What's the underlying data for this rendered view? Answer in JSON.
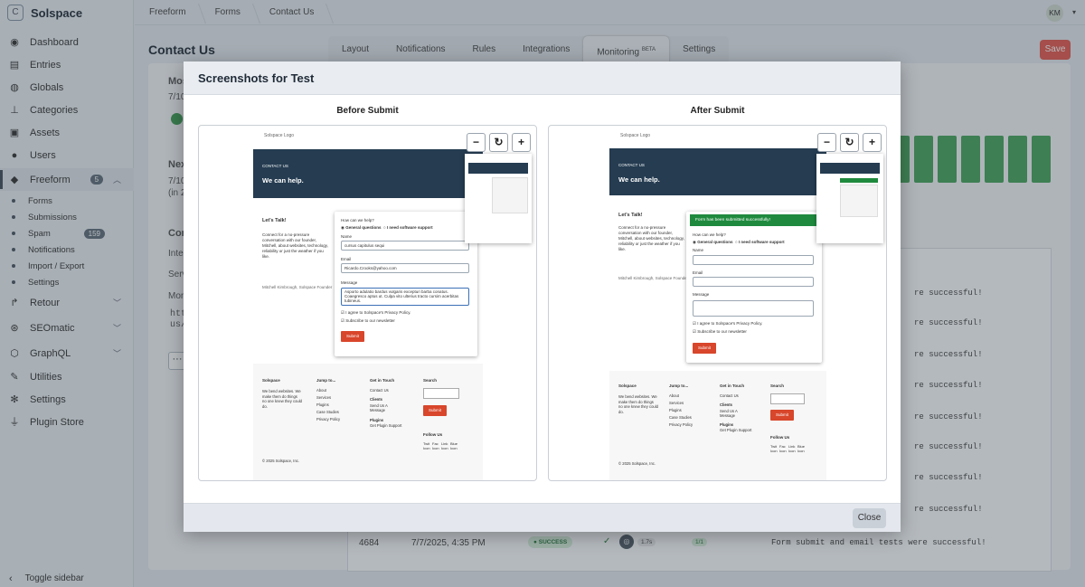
{
  "site": {
    "name": "Solspace",
    "logo_letter": "C"
  },
  "sidebar": {
    "items": [
      {
        "label": "Dashboard",
        "icon": "gauge-icon"
      },
      {
        "label": "Entries",
        "icon": "newspaper-icon"
      },
      {
        "label": "Globals",
        "icon": "globe-icon"
      },
      {
        "label": "Categories",
        "icon": "sitemap-icon"
      },
      {
        "label": "Assets",
        "icon": "image-icon"
      },
      {
        "label": "Users",
        "icon": "user-icon"
      },
      {
        "label": "Freeform",
        "icon": "freeform-icon",
        "badge": "5"
      },
      {
        "label": "Retour",
        "icon": "retour-icon"
      },
      {
        "label": "SEOmatic",
        "icon": "seomatic-icon"
      },
      {
        "label": "GraphQL",
        "icon": "graphql-icon"
      },
      {
        "label": "Utilities",
        "icon": "wrench-icon"
      },
      {
        "label": "Settings",
        "icon": "gear-icon"
      },
      {
        "label": "Plugin Store",
        "icon": "plug-icon"
      }
    ],
    "freeform_sub": [
      {
        "label": "Forms"
      },
      {
        "label": "Submissions"
      },
      {
        "label": "Spam",
        "badge": "159"
      },
      {
        "label": "Notifications"
      },
      {
        "label": "Import / Export"
      },
      {
        "label": "Settings"
      }
    ],
    "toggle": "Toggle sidebar"
  },
  "breadcrumb": [
    "Freeform",
    "Forms",
    "Contact Us"
  ],
  "user": {
    "initials": "KM"
  },
  "page": {
    "title": "Contact Us",
    "save": "Save"
  },
  "tabs": [
    {
      "label": "Layout"
    },
    {
      "label": "Notifications"
    },
    {
      "label": "Rules"
    },
    {
      "label": "Integrations"
    },
    {
      "label": "Monitoring",
      "sup": "BETA"
    },
    {
      "label": "Settings"
    }
  ],
  "background": {
    "t1": "Mos",
    "t2": "7/10",
    "t3": "Nex",
    "t4": "7/10",
    "t5": "(in 2",
    "t6": "Con",
    "t7": "Integ",
    "t8": "Serv",
    "t9": "Mon",
    "t10": "http",
    "t11": "us/",
    "rows": [
      {
        "id": "",
        "date": "",
        "msg": "re successful!"
      },
      {
        "id": "",
        "date": "",
        "msg": "re successful!"
      },
      {
        "id": "",
        "date": "",
        "msg": "re successful!"
      },
      {
        "id": "",
        "date": "",
        "msg": "re successful!"
      },
      {
        "id": "",
        "date": "",
        "msg": "re successful!"
      },
      {
        "id": "",
        "date": "",
        "msg": "re successful!"
      },
      {
        "id": "",
        "date": "",
        "msg": "re successful!"
      },
      {
        "id": "",
        "date": "",
        "msg": "re successful!"
      },
      {
        "id": "4684",
        "date": "7/7/2025, 4:35 PM",
        "status": "SUCCESS",
        "time": "1.7s",
        "count": "1/1",
        "msg": "Form submit and email tests were successful!"
      }
    ]
  },
  "modal": {
    "title": "Screenshots for Test",
    "before": "Before Submit",
    "after": "After Submit",
    "close": "Close",
    "shot": {
      "logo_alt": "Solspace Logo",
      "kicker": "CONTACT US",
      "headline": "We can help.",
      "lets_talk": "Let's Talk!",
      "blurb": "Connect for a no-pressure conversation with our founder, Mitchell, about websites, technology, reliability or just the weather if you like.",
      "photo_alt": "Mitchell Kimbrough, Solspace Founder",
      "q": "How can we help?",
      "opt1": "General questions",
      "opt2": "I need software support",
      "name_label": "Name",
      "name_val": "cursus capitulus sequi",
      "email_label": "Email",
      "email_val": "Ricardo.Crooks@yahoo.com",
      "msg_label": "Message",
      "msg_val": "Asporto adulatio bardus vulgaris excepturi barba conatus. Coaegresco aptus ut. Culpa vito ulterius tracto cursim acerbitas tubineus.",
      "agree": "I agree to Solspace's Privacy Policy.",
      "subscribe": "Subscribe to our newsletter",
      "submit": "Submit",
      "success": "Form has been submitted successfully!",
      "f_solspace": "Solspace",
      "f_tag": "We bend websites. We make them do things no one knew they could do.",
      "f_jump": "Jump to...",
      "f_links": [
        "About",
        "Services",
        "Plugins",
        "Case Studies",
        "Privacy Policy"
      ],
      "f_touch": "Get in Touch",
      "f_contact": "Contact Us",
      "f_clients": "Clients",
      "f_send": "Send Us A Message",
      "f_plugins": "Plugins",
      "f_support": "Get Plugin Support",
      "f_search": "Search",
      "f_follow": "Follow Us",
      "f_icons": [
        "Twit Icon",
        "Fac Icon",
        "Link Icon",
        "Blue Icon"
      ],
      "copyright": "© 2025 Solspace, Inc."
    }
  }
}
